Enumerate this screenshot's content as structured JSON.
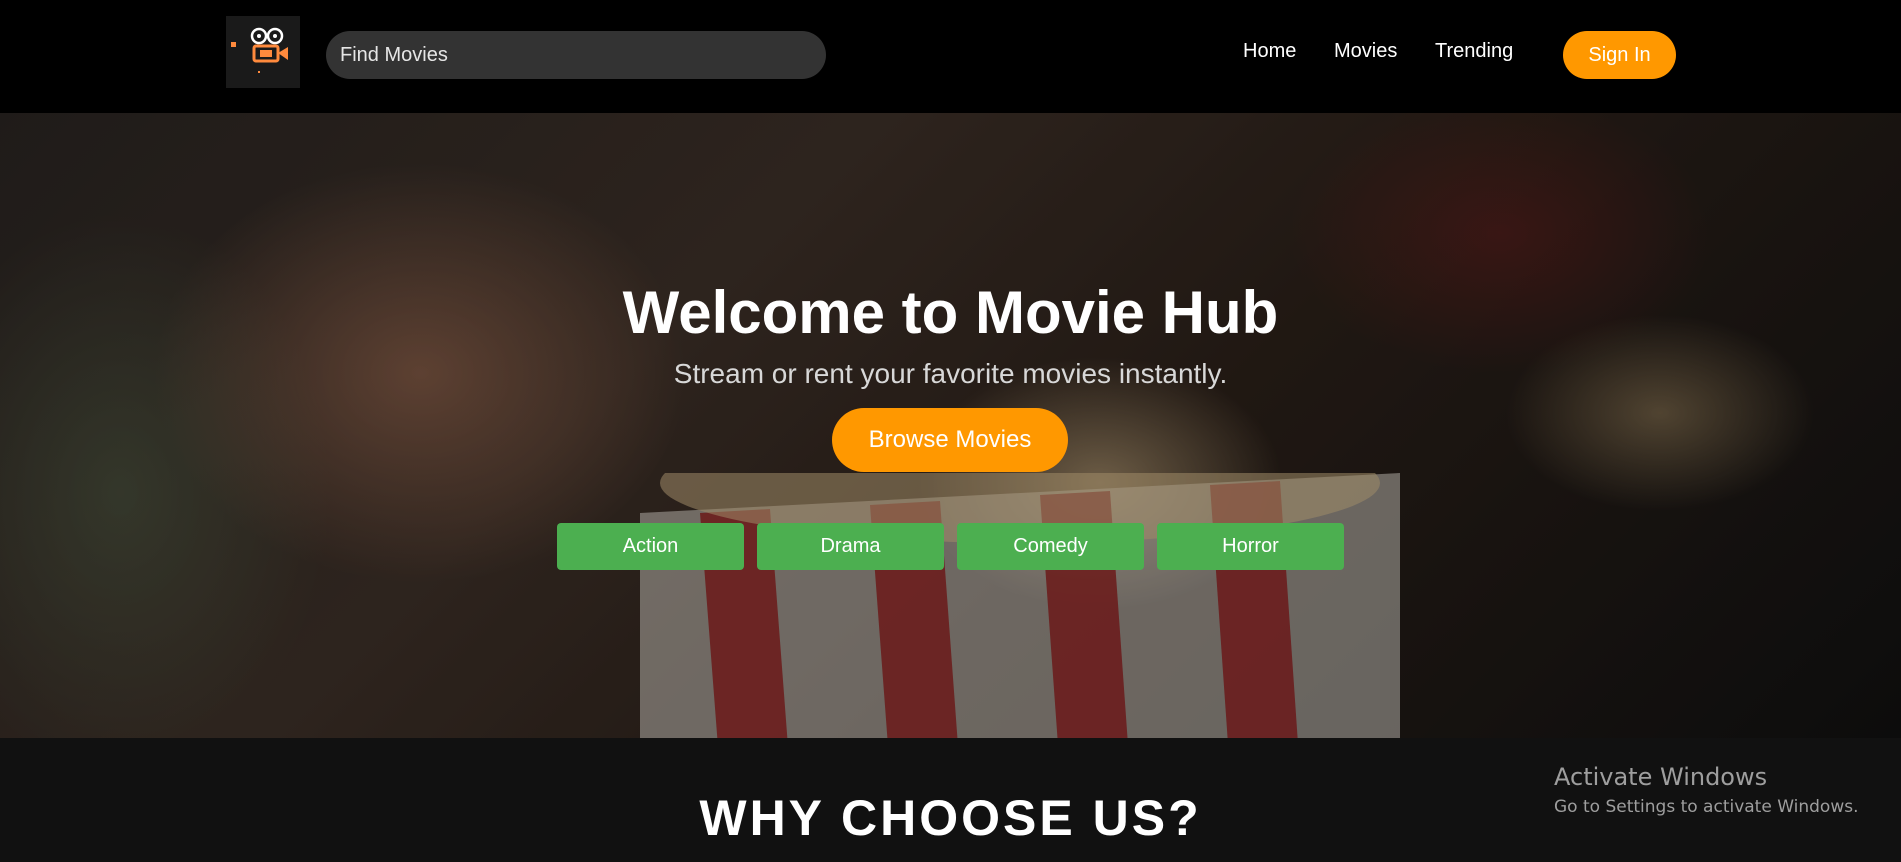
{
  "header": {
    "logo_icon": "movie-camera-icon",
    "search": {
      "placeholder": "Find Movies",
      "value": ""
    },
    "nav": [
      "Home",
      "Movies",
      "Trending"
    ],
    "signin_label": "Sign In",
    "accent_color": "#ff9800"
  },
  "hero": {
    "background": "popcorn-photo",
    "title": "Welcome to Movie Hub",
    "subtitle": "Stream or rent your favorite movies instantly.",
    "browse_label": "Browse Movies",
    "genres": [
      "Action",
      "Drama",
      "Comedy",
      "Horror"
    ],
    "genre_color": "#4caf50"
  },
  "why": {
    "title": "WHY CHOOSE US?"
  },
  "watermark": {
    "title": "Activate Windows",
    "subtitle": "Go to Settings to activate Windows."
  }
}
